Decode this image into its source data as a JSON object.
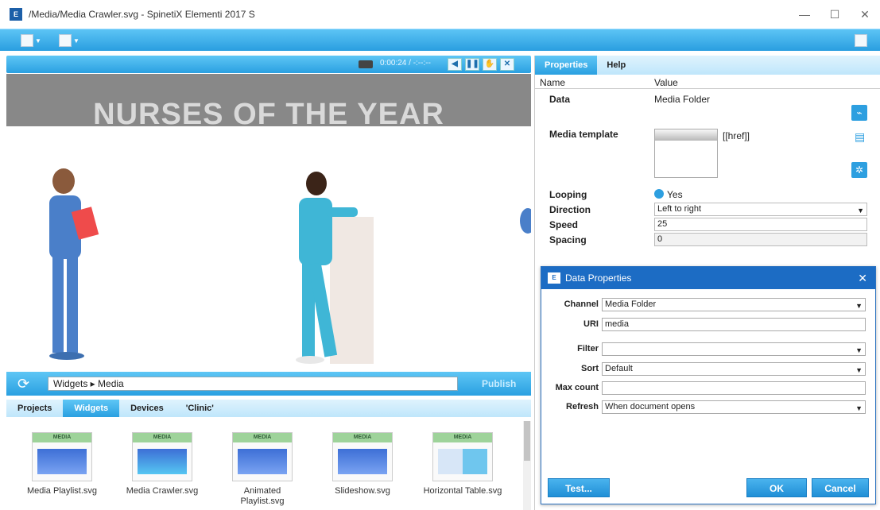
{
  "window": {
    "title": "/Media/Media Crawler.svg - SpinetiX Elementi 2017 S",
    "app_icon": "E",
    "minimize_icon": "—",
    "maximize_icon": "☐",
    "close_icon": "✕"
  },
  "player": {
    "time": "0:00:24 / -:--:--",
    "banner_text": "NURSES OF THE YEAR"
  },
  "path_bar": {
    "path": "Widgets ▸ Media",
    "publish_label": "Publish"
  },
  "bottom_tabs": [
    {
      "label": "Projects",
      "active": false
    },
    {
      "label": "Widgets",
      "active": true
    },
    {
      "label": "Devices",
      "active": false
    },
    {
      "label": "'Clinic'",
      "active": false
    }
  ],
  "widgets": [
    {
      "label": "Media Playlist.svg",
      "badge": "MEDIA"
    },
    {
      "label": "Media Crawler.svg",
      "badge": "MEDIA"
    },
    {
      "label": "Animated Playlist.svg",
      "badge": "MEDIA"
    },
    {
      "label": "Slideshow.svg",
      "badge": "MEDIA"
    },
    {
      "label": "Horizontal Table.svg",
      "badge": "MEDIA"
    }
  ],
  "right_tabs": [
    {
      "label": "Properties",
      "active": true
    },
    {
      "label": "Help",
      "active": false
    }
  ],
  "properties": {
    "col_name": "Name",
    "col_value": "Value",
    "data_label": "Data",
    "data_value": "Media Folder",
    "template_label": "Media template",
    "template_value": "[[href]]",
    "looping_label": "Looping",
    "looping_value": "Yes",
    "direction_label": "Direction",
    "direction_value": "Left to right",
    "speed_label": "Speed",
    "speed_value": "25",
    "spacing_label": "Spacing",
    "spacing_value": "0"
  },
  "dialog": {
    "title": "Data Properties",
    "channel_label": "Channel",
    "channel_value": "Media Folder",
    "uri_label": "URI",
    "uri_value": "media",
    "filter_label": "Filter",
    "filter_value": "",
    "sort_label": "Sort",
    "sort_value": "Default",
    "maxcount_label": "Max count",
    "maxcount_value": "",
    "refresh_label": "Refresh",
    "refresh_value": "When document opens",
    "test_label": "Test...",
    "ok_label": "OK",
    "cancel_label": "Cancel"
  },
  "colors": {
    "accent": "#2aa0e1",
    "dialog_title": "#1c6cc4",
    "banner": "#888888"
  }
}
